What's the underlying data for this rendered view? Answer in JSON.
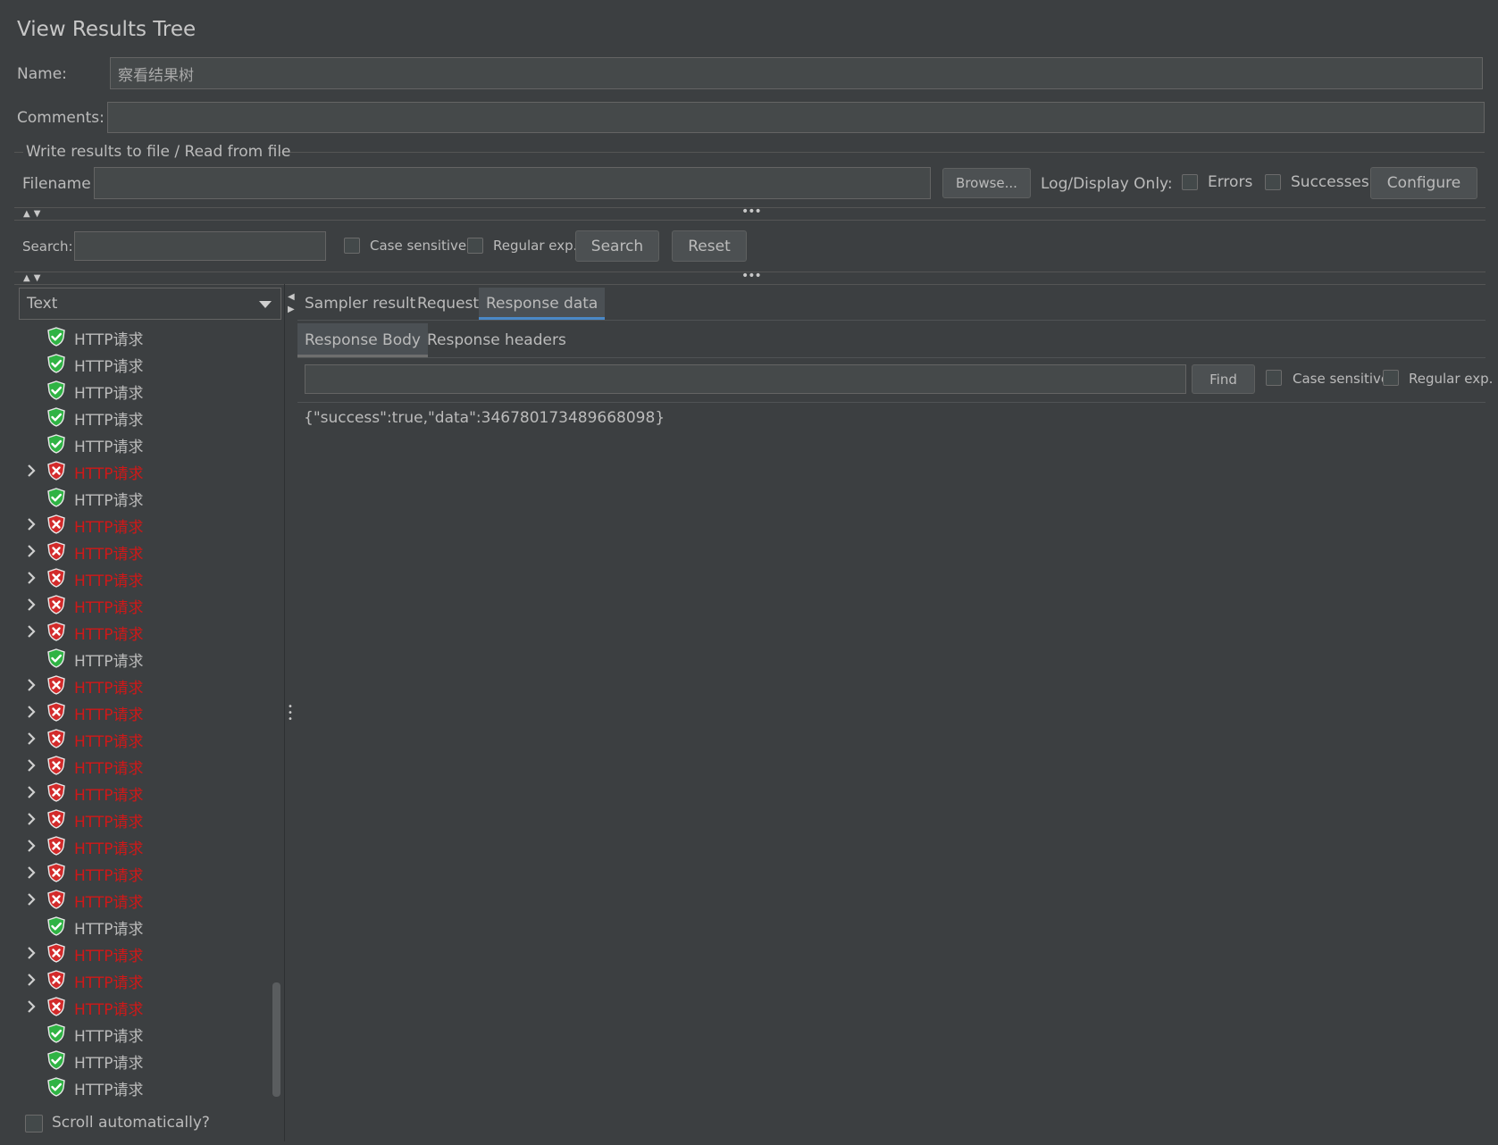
{
  "window": {
    "title": "View Results Tree"
  },
  "form": {
    "name_label": "Name:",
    "name_value": "察看结果树",
    "comments_label": "Comments:",
    "comments_value": "",
    "file_group_title": "Write results to file / Read from file",
    "filename_label": "Filename",
    "filename_value": "",
    "browse_label": "Browse...",
    "log_display_label": "Log/Display Only:",
    "errors_label": "Errors",
    "successes_label": "Successes",
    "configure_label": "Configure"
  },
  "search": {
    "label": "Search:",
    "value": "",
    "case_sensitive_label": "Case sensitive",
    "regex_label": "Regular exp.",
    "search_button": "Search",
    "reset_button": "Reset"
  },
  "renderer": {
    "selected": "Text"
  },
  "tree": {
    "items": [
      {
        "label": "HTTP请求",
        "status": "success"
      },
      {
        "label": "HTTP请求",
        "status": "success"
      },
      {
        "label": "HTTP请求",
        "status": "success"
      },
      {
        "label": "HTTP请求",
        "status": "success"
      },
      {
        "label": "HTTP请求",
        "status": "success"
      },
      {
        "label": "HTTP请求",
        "status": "error"
      },
      {
        "label": "HTTP请求",
        "status": "success"
      },
      {
        "label": "HTTP请求",
        "status": "error"
      },
      {
        "label": "HTTP请求",
        "status": "error"
      },
      {
        "label": "HTTP请求",
        "status": "error"
      },
      {
        "label": "HTTP请求",
        "status": "error"
      },
      {
        "label": "HTTP请求",
        "status": "error"
      },
      {
        "label": "HTTP请求",
        "status": "success"
      },
      {
        "label": "HTTP请求",
        "status": "error"
      },
      {
        "label": "HTTP请求",
        "status": "error"
      },
      {
        "label": "HTTP请求",
        "status": "error"
      },
      {
        "label": "HTTP请求",
        "status": "error"
      },
      {
        "label": "HTTP请求",
        "status": "error"
      },
      {
        "label": "HTTP请求",
        "status": "error"
      },
      {
        "label": "HTTP请求",
        "status": "error"
      },
      {
        "label": "HTTP请求",
        "status": "error"
      },
      {
        "label": "HTTP请求",
        "status": "error"
      },
      {
        "label": "HTTP请求",
        "status": "success"
      },
      {
        "label": "HTTP请求",
        "status": "error"
      },
      {
        "label": "HTTP请求",
        "status": "error"
      },
      {
        "label": "HTTP请求",
        "status": "error"
      },
      {
        "label": "HTTP请求",
        "status": "success"
      },
      {
        "label": "HTTP请求",
        "status": "success"
      },
      {
        "label": "HTTP请求",
        "status": "success"
      }
    ],
    "scroll_auto_label": "Scroll automatically?"
  },
  "result_tabs": [
    "Sampler result",
    "Request",
    "Response data"
  ],
  "active_result_tab": "Response data",
  "response_tabs": [
    "Response Body",
    "Response headers"
  ],
  "active_response_tab": "Response Body",
  "response": {
    "find_value": "",
    "find_button": "Find",
    "case_sensitive_label": "Case sensitive",
    "regex_label": "Regular exp.",
    "body": "{\"success\":true,\"data\":346780173489668098}"
  },
  "colors": {
    "background": "#3c3f41",
    "error_text": "#d01818",
    "success_icon": "#2fb344",
    "error_icon": "#d32a2a",
    "tab_accent": "#4a88c7"
  }
}
